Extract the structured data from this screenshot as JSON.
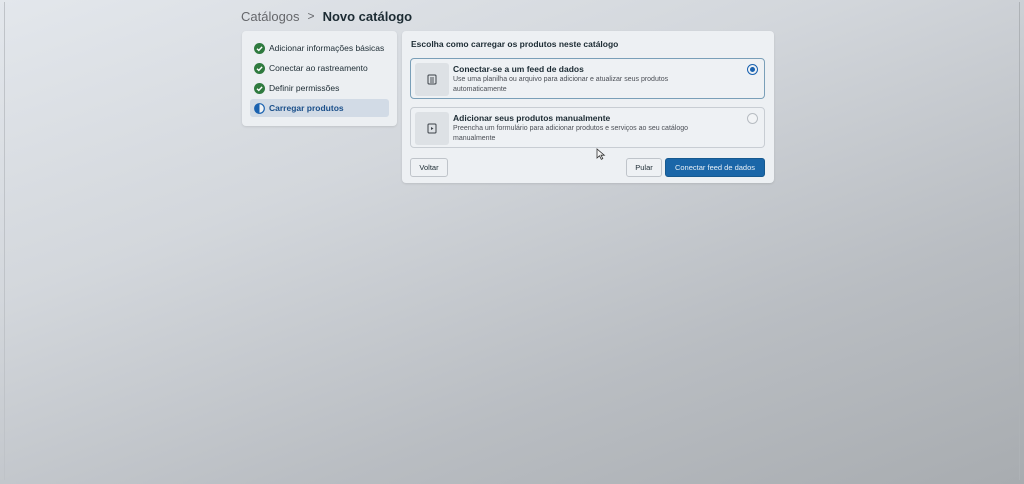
{
  "breadcrumb": {
    "root": "Catálogos",
    "separator": ">",
    "current": "Novo catálogo"
  },
  "steps": [
    {
      "label": "Adicionar informações básicas",
      "status": "done"
    },
    {
      "label": "Conectar ao rastreamento",
      "status": "done"
    },
    {
      "label": "Definir permissões",
      "status": "done"
    },
    {
      "label": "Carregar produtos",
      "status": "in-progress"
    }
  ],
  "main": {
    "title": "Escolha como carregar os produtos neste catálogo",
    "options": [
      {
        "title": "Conectar-se a um feed de dados",
        "description": "Use uma planilha ou arquivo para adicionar e atualizar seus produtos automaticamente",
        "icon": "spreadsheet-icon",
        "selected": true
      },
      {
        "title": "Adicionar seus produtos manualmente",
        "description": "Preencha um formulário para adicionar produtos e serviços ao seu catálogo manualmente",
        "icon": "form-icon",
        "selected": false
      }
    ]
  },
  "buttons": {
    "back": "Voltar",
    "skip": "Pular",
    "primary": "Conectar feed de dados"
  },
  "colors": {
    "accent": "#1a66a8",
    "success": "#2f7a3f",
    "active_step_bg": "#d2dbe6"
  }
}
